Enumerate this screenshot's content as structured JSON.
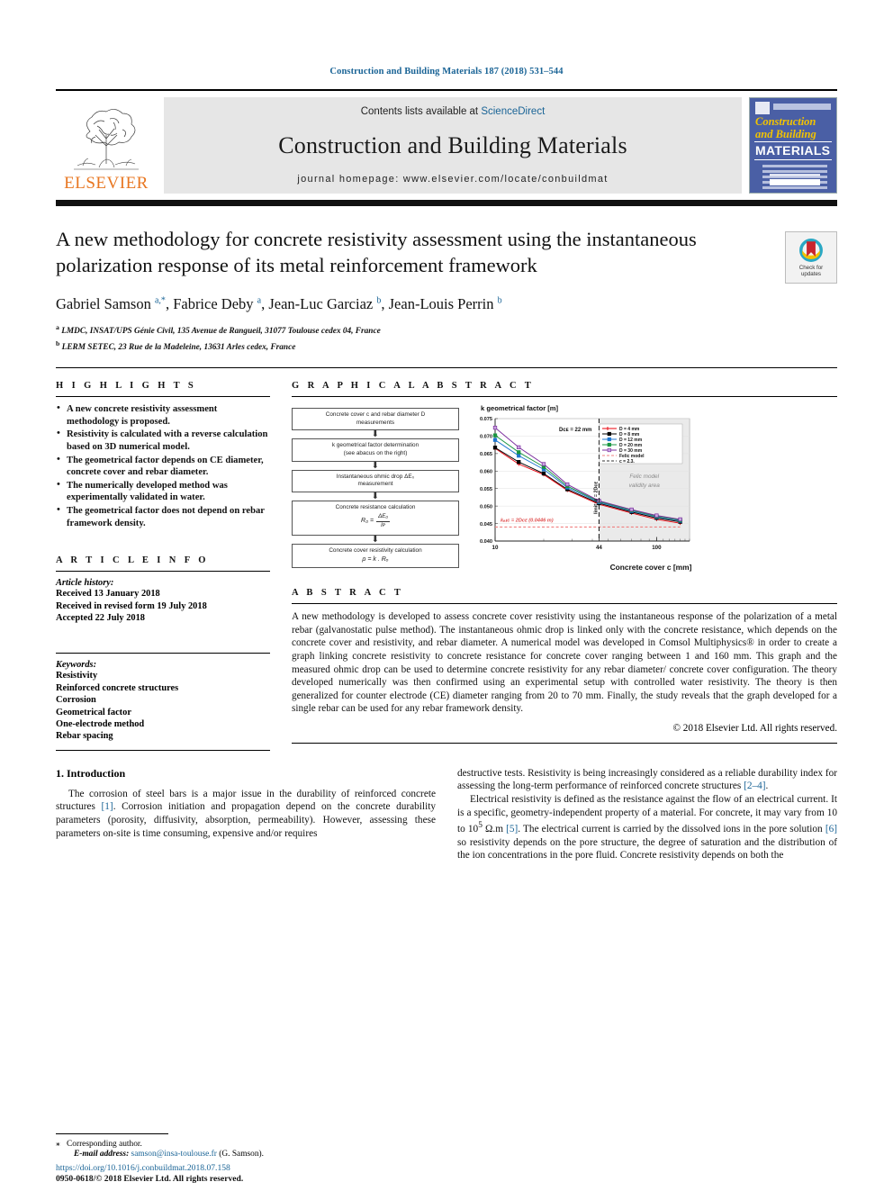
{
  "running_head": "Construction and Building Materials 187 (2018) 531–544",
  "masthead": {
    "contents_prefix": "Contents lists available at ",
    "sciencedirect": "ScienceDirect",
    "journal_title": "Construction and Building Materials",
    "homepage": "journal homepage: www.elsevier.com/locate/conbuildmat",
    "publisher": "ELSEVIER",
    "cover": {
      "line1": "Construction",
      "line2": "and Building",
      "line3": "MATERIALS"
    }
  },
  "article": {
    "title": "A new methodology for concrete resistivity assessment using the instantaneous polarization response of its metal reinforcement framework",
    "authors_html": "Gabriel Samson <sup>a,*</sup>, Fabrice Deby <sup>a</sup>, Jean-Luc Garciaz <sup>b</sup>, Jean-Louis Perrin <sup>b</sup>",
    "affiliation_a": "LMDC, INSAT/UPS Génie Civil, 135 Avenue de Rangueil, 31077 Toulouse cedex 04, France",
    "affiliation_b": "LERM SETEC, 23 Rue de la Madeleine, 13631 Arles cedex, France",
    "crossmark_label_1": "Check for",
    "crossmark_label_2": "updates"
  },
  "highlights": {
    "heading": "H I G H L I G H T S",
    "items": [
      "A new concrete resistivity assessment methodology is proposed.",
      "Resistivity is calculated with a reverse calculation based on 3D numerical model.",
      "The geometrical factor depends on CE diameter, concrete cover and rebar diameter.",
      "The numerically developed method was experimentally validated in water.",
      "The geometrical factor does not depend on rebar framework density."
    ]
  },
  "article_info": {
    "heading": "A R T I C L E    I N F O",
    "history_label": "Article history:",
    "history": [
      "Received 13 January 2018",
      "Received in revised form 19 July 2018",
      "Accepted 22 July 2018"
    ],
    "keywords_label": "Keywords:",
    "keywords": [
      "Resistivity",
      "Reinforced concrete structures",
      "Corrosion",
      "Geometrical factor",
      "One-electrode method",
      "Rebar spacing"
    ]
  },
  "graphical_abstract": {
    "heading": "G R A P H I C A L   A B S T R A C T",
    "flowchart": [
      {
        "line1": "Concrete cover c and rebar diameter D",
        "line2": "measurements"
      },
      {
        "line1": "k geometrical factor determination",
        "line2": "(see abacus on the right)"
      },
      {
        "line1": "Instantaneous ohmic drop ΔE₀",
        "line2": "measurement"
      },
      {
        "line1": "Concrete resistance calculation",
        "formula_lhs": "R₀ =",
        "formula_num": "ΔE₀",
        "formula_den": "Iᴘ"
      },
      {
        "line1": "Concrete cover resistivity calculation",
        "formula": "ρ = k . Rₒ"
      }
    ]
  },
  "chart_data": {
    "type": "line",
    "title": "k geometrical factor [m]",
    "xlabel": "Concrete cover c [mm]",
    "ylabel": "k geometrical factor [m]",
    "xscale": "log",
    "xlim": [
      10,
      160
    ],
    "ylim": [
      0.04,
      0.075
    ],
    "yticks": [
      0.04,
      0.045,
      0.05,
      0.055,
      0.06,
      0.065,
      0.07,
      0.075
    ],
    "ytick_labels": [
      "0.040",
      "0.045",
      "0.050",
      "0.055",
      "0.060",
      "0.065",
      "0.070",
      "0.075"
    ],
    "xticks": [
      10,
      44,
      100
    ],
    "xtick_labels": [
      "10",
      "44",
      "100"
    ],
    "grid": true,
    "legend_position": "top-right",
    "annotations": [
      {
        "text": "Dᴄᴇ = 22 mm",
        "role": "ce-diameter-label"
      },
      {
        "text": "limit: c = 2Dᴄᴇ",
        "role": "vertical-limit-label"
      },
      {
        "text": "Felic model validity area",
        "role": "shaded-region-label"
      },
      {
        "text": "k₟ₑₗᵢᴄ = 2Dᴄᴇ (0.0446 m)",
        "role": "horizontal-asymptote-label"
      }
    ],
    "categories": [
      10,
      14,
      20,
      28,
      44,
      70,
      100,
      140
    ],
    "series": [
      {
        "name": "D = 4 mm",
        "color": "#e8000b",
        "marker": "plus",
        "values": [
          0.0665,
          0.062,
          0.059,
          0.0545,
          0.0505,
          0.048,
          0.0462,
          0.0451
        ]
      },
      {
        "name": "D = 8 mm",
        "color": "#000000",
        "marker": "square",
        "values": [
          0.0667,
          0.0626,
          0.0593,
          0.0548,
          0.0508,
          0.0483,
          0.0466,
          0.0455
        ]
      },
      {
        "name": "D = 12 mm",
        "color": "#1f77d0",
        "marker": "square",
        "values": [
          0.0689,
          0.0644,
          0.0605,
          0.0553,
          0.0511,
          0.0486,
          0.0469,
          0.0458
        ]
      },
      {
        "name": "D = 20 mm",
        "color": "#1a9641",
        "marker": "square",
        "values": [
          0.0702,
          0.0654,
          0.0612,
          0.0557,
          0.0513,
          0.0488,
          0.0471,
          0.046
        ]
      },
      {
        "name": "D = 30 mm",
        "color": "#7b2d9e",
        "marker": "square",
        "values": [
          0.0724,
          0.0668,
          0.062,
          0.0562,
          0.0515,
          0.049,
          0.0473,
          0.0462
        ]
      },
      {
        "name": "Felic model",
        "color": "#f08080",
        "marker": "dashed",
        "values": [
          0.044,
          0.044,
          0.044,
          0.044,
          0.044,
          0.044,
          0.044,
          0.044
        ]
      },
      {
        "name": "c = 2.3.",
        "color": "#333333",
        "marker": "dashed-vertical",
        "values": []
      }
    ]
  },
  "abstract": {
    "heading": "A B S T R A C T",
    "text": "A new methodology is developed to assess concrete cover resistivity using the instantaneous response of the polarization of a metal rebar (galvanostatic pulse method). The instantaneous ohmic drop is linked only with the concrete resistance, which depends on the concrete cover and resistivity, and rebar diameter. A numerical model was developed in Comsol Multiphysics® in order to create a graph linking concrete resistivity to concrete resistance for concrete cover ranging between 1 and 160 mm. This graph and the measured ohmic drop can be used to determine concrete resistivity for any rebar diameter/ concrete cover configuration. The theory developed numerically was then confirmed using an experimental setup with controlled water resistivity. The theory is then generalized for counter electrode (CE) diameter ranging from 20 to 70 mm. Finally, the study reveals that the graph developed for a single rebar can be used for any rebar framework density.",
    "copyright": "© 2018 Elsevier Ltd. All rights reserved."
  },
  "body": {
    "section_title": "1. Introduction",
    "col1_p1_a": "The corrosion of steel bars is a major issue in the durability of reinforced concrete structures ",
    "col1_p1_ref1": "[1]",
    "col1_p1_b": ". Corrosion initiation and propagation depend on the concrete durability parameters (porosity, diffusivity, absorption, permeability). However, assessing these parameters on-site is time consuming, expensive and/or requires",
    "col2_p1_a": "destructive tests. Resistivity is being increasingly considered as a reliable durability index for assessing the long-term performance of reinforced concrete structures ",
    "col2_p1_ref": "[2–4]",
    "col2_p1_b": ".",
    "col2_p2_a": "Electrical resistivity is defined as the resistance against the flow of an electrical current. It is a specific, geometry-independent property of a material. For concrete, it may vary from 10 to 10",
    "col2_p2_sup": "5",
    "col2_p2_b": " Ω.m ",
    "col2_p2_ref1": "[5]",
    "col2_p2_c": ". The electrical current is carried by the dissolved ions in the pore solution ",
    "col2_p2_ref2": "[6]",
    "col2_p2_d": " so resistivity depends on the pore structure, the degree of saturation and the distribution of the ion concentrations in the pore fluid. Concrete resistivity depends on both the"
  },
  "footer": {
    "corresponding_star": "⁎",
    "corresponding": "Corresponding author.",
    "email_label": "E-mail address:",
    "email": "samson@insa-toulouse.fr",
    "email_suffix": "(G. Samson).",
    "doi": "https://doi.org/10.1016/j.conbuildmat.2018.07.158",
    "issn_line": "0950-0618/© 2018 Elsevier Ltd. All rights reserved."
  },
  "colors": {
    "link": "#1a6496",
    "elsevier_orange": "#E87722",
    "cover_blue": "#4a5fa5"
  }
}
